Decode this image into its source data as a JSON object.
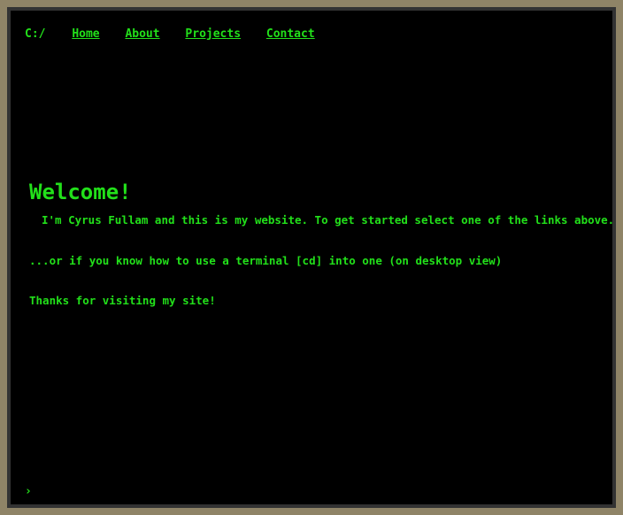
{
  "nav": {
    "path": "C:/",
    "links": [
      "Home",
      "About",
      "Projects",
      "Contact"
    ]
  },
  "main": {
    "heading": "Welcome!",
    "intro": "I'm Cyrus Fullam and this is my website. To get started select one of the links above.",
    "terminal_hint": "...or if you know how to use a terminal [cd] into one (on desktop view)",
    "thanks": "Thanks for visiting my site!"
  },
  "command_line": {
    "prompt": "›"
  },
  "colors": {
    "text": "#22e01a",
    "terminal_bg": "#000000",
    "frame": "#333333",
    "page_bg": "#8f8467"
  }
}
